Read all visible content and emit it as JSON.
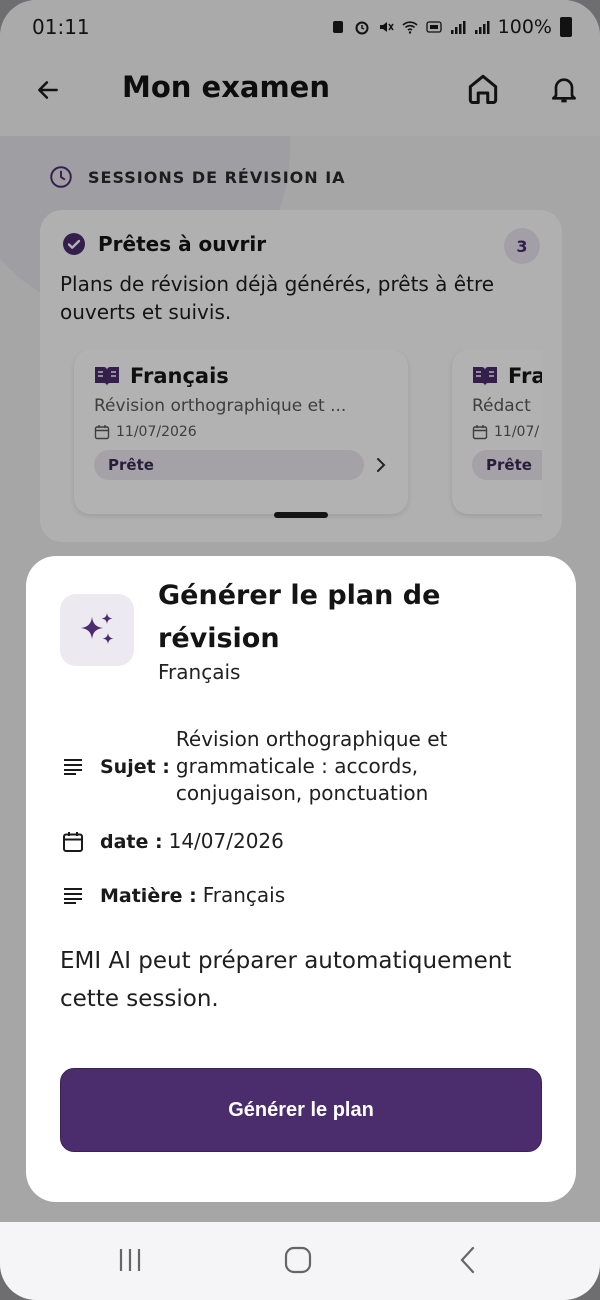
{
  "status_bar": {
    "time": "01:11",
    "battery": "100%"
  },
  "app_bar": {
    "title": "Mon examen"
  },
  "sessions": {
    "section_title": "SESSIONS DE RÉVISION IA",
    "group": {
      "title": "Prêtes à ouvrir",
      "count": "3",
      "description": "Plans de révision déjà générés, prêts à être ouverts et suivis."
    },
    "cards": [
      {
        "subject": "Français",
        "description": "Révision orthographique et ...",
        "date": "11/07/2026",
        "status": "Prête"
      },
      {
        "subject": "Fra",
        "description": "Rédact",
        "date": "11/07/",
        "status": "Prête"
      }
    ]
  },
  "sheet": {
    "title": "Générer le plan de révision",
    "subtitle": "Français",
    "subject_label": "Sujet :",
    "subject_value": "Révision orthographique et grammaticale : accords, conjugaison, ponctuation",
    "date_label": "date :",
    "date_value": "14/07/2026",
    "matter_label": "Matière :",
    "matter_value": "Français",
    "description": "EMI AI peut préparer automatiquement cette session.",
    "button_label": "Générer le plan"
  },
  "colors": {
    "accent": "#4b2d6e",
    "accent_soft": "#ece9f1",
    "backdrop": "#6e6e71"
  }
}
